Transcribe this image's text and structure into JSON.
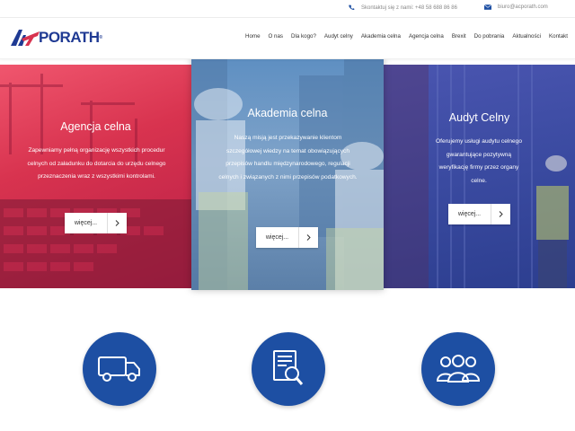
{
  "topbar": {
    "phone_label": "Skontaktuj się z nami: +48 58 688 86 86",
    "email_label": "biuro@acporath.com"
  },
  "header": {
    "logo_text": "PORATH",
    "logo_mark": "AC",
    "nav": [
      {
        "label": "Home"
      },
      {
        "label": "O nas"
      },
      {
        "label": "Dla kogo?"
      },
      {
        "label": "Audyt celny"
      },
      {
        "label": "Akademia celna"
      },
      {
        "label": "Agencja celna"
      },
      {
        "label": "Brexit"
      },
      {
        "label": "Do pobrania"
      },
      {
        "label": "Aktualności"
      },
      {
        "label": "Kontakt"
      }
    ]
  },
  "panels": {
    "left": {
      "title": "Agencja celna",
      "text": "Zapewniamy pełną organizację wszystkich procedur celnych od załadunku do dotarcia do urzędu celnego przeznaczenia wraz z wszystkimi kontrolami.",
      "button": "więcej..."
    },
    "mid": {
      "title": "Akademia celna",
      "text": "Naszą misją jest przekazywanie klientom szczegółowej wiedzy na temat obowiązujących przepisów handlu międzynarodowego, regulacji celnych i związanych z nimi przepisów podatkowych.",
      "button": "więcej..."
    },
    "right": {
      "title": "Audyt Celny",
      "text": "Oferujemy usługi audytu celnego gwarantujące pozytywną weryfikację firmy przez organy celne.",
      "button": "więcej..."
    }
  },
  "features": [
    {
      "icon": "truck-icon"
    },
    {
      "icon": "document-search-icon"
    },
    {
      "icon": "people-group-icon"
    }
  ],
  "colors": {
    "brand_blue": "#1d4fa3",
    "brand_red": "#d8334f",
    "left_panel": "#d8334f",
    "mid_panel": "#6f98c6",
    "right_panel": "#3a4aa0"
  }
}
